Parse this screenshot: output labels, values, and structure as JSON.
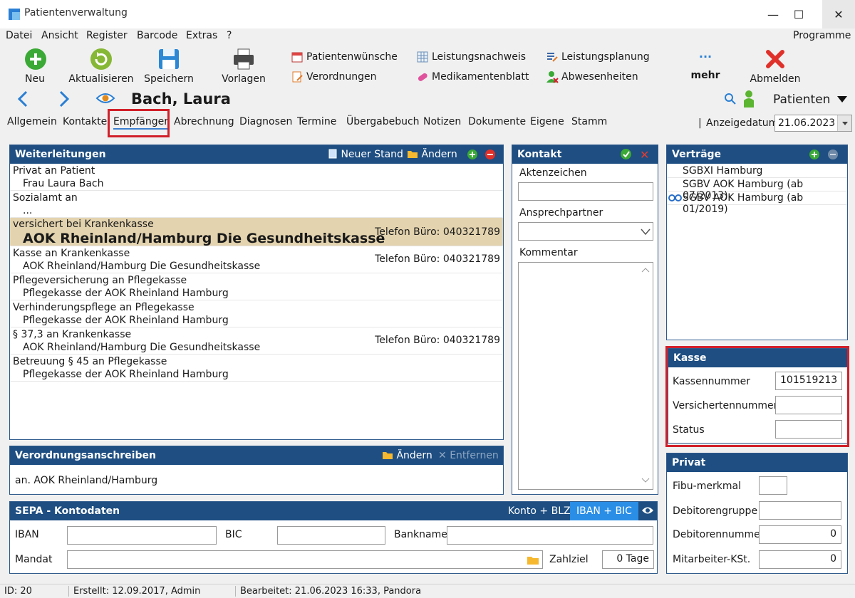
{
  "window": {
    "title": "Patientenverwaltung",
    "controls": {
      "minimize": "—",
      "maximize": "☐",
      "close": "✕"
    }
  },
  "menu": {
    "items": [
      "Datei",
      "Ansicht",
      "Register",
      "Barcode",
      "Extras",
      "?"
    ],
    "right": "Programme"
  },
  "toolbar": {
    "neu": "Neu",
    "aktualisieren": "Aktualisieren",
    "speichern": "Speichern",
    "vorlagen": "Vorlagen",
    "patientenwuensche": "Patientenwünsche",
    "verordnungen": "Verordnungen",
    "leistungsnachweis": "Leistungsnachweis",
    "medikamentenblatt": "Medikamentenblatt",
    "leistungsplanung": "Leistungsplanung",
    "abwesenheiten": "Abwesenheiten",
    "mehr_dots": "···",
    "mehr": "mehr",
    "abmelden": "Abmelden"
  },
  "nav": {
    "patient_name": "Bach, Laura",
    "patienten_dropdown": "Patienten"
  },
  "tabs": [
    "Allgemein",
    "Kontakte",
    "Empfänger",
    "Abrechnung",
    "Diagnosen",
    "Termine",
    "Übergabebuch",
    "Notizen",
    "Dokumente",
    "Eigene",
    "Stamm"
  ],
  "active_tab": "Empfänger",
  "anzeigedatum": {
    "sep": "|",
    "label": "Anzeigedatum",
    "value": "21.06.2023"
  },
  "weiterleitungen": {
    "title": "Weiterleitungen",
    "neuer_stand": "Neuer Stand",
    "aendern": "Ändern",
    "rows": [
      {
        "line1": "Privat an Patient",
        "line2": "Frau Laura Bach",
        "tel": ""
      },
      {
        "line1": "Sozialamt an",
        "line2": "...",
        "tel": ""
      },
      {
        "line1": "versichert bei Krankenkasse",
        "line2": "AOK Rheinland/Hamburg Die Gesundheitskasse",
        "tel": "Telefon Büro: 040321789"
      },
      {
        "line1": "Kasse an Krankenkasse",
        "line2": "AOK Rheinland/Hamburg Die Gesundheitskasse",
        "tel": "Telefon Büro: 040321789"
      },
      {
        "line1": "Pflegeversicherung an Pflegekasse",
        "line2": "Pflegekasse der AOK Rheinland Hamburg",
        "tel": ""
      },
      {
        "line1": "Verhinderungspflege an Pflegekasse",
        "line2": "Pflegekasse der AOK Rheinland Hamburg",
        "tel": ""
      },
      {
        "line1": "§ 37,3 an Krankenkasse",
        "line2": "AOK Rheinland/Hamburg Die Gesundheitskasse",
        "tel": "Telefon Büro: 040321789"
      },
      {
        "line1": "Betreuung § 45 an Pflegekasse",
        "line2": "Pflegekasse der AOK Rheinland Hamburg",
        "tel": ""
      }
    ]
  },
  "verordnung": {
    "title": "Verordnungsanschreiben",
    "aendern": "Ändern",
    "entfernen": "Entfernen",
    "text": "an. AOK Rheinland/Hamburg"
  },
  "sepa": {
    "title": "SEPA - Kontodaten",
    "konto_blz": "Konto + BLZ",
    "iban_bic": "IBAN + BIC",
    "iban_label": "IBAN",
    "bic_label": "BIC",
    "bankname_label": "Bankname",
    "mandat_label": "Mandat",
    "zahlziel_label": "Zahlziel",
    "zahlziel_value": "0 Tage"
  },
  "kontakt": {
    "title": "Kontakt",
    "aktenzeichen": "Aktenzeichen",
    "ansprechpartner": "Ansprechpartner",
    "kommentar": "Kommentar"
  },
  "vertraege": {
    "title": "Verträge",
    "items": [
      "SGBXI Hamburg",
      "SGBV AOK Hamburg (ab 07/2013)",
      "SGBV AOK Hamburg (ab 01/2019)"
    ]
  },
  "kasse": {
    "title": "Kasse",
    "kassennummer_label": "Kassennummer",
    "kassennummer_value": "101519213",
    "versichertennummer_label": "Versichertennummer",
    "status_label": "Status"
  },
  "privat": {
    "title": "Privat",
    "fibu_label": "Fibu-merkmal",
    "debitorengruppe_label": "Debitorengruppe",
    "debitorennummer_label": "Debitorennummer",
    "debitorennummer_value": "0",
    "mitarbeiter_label": "Mitarbeiter-KSt.",
    "mitarbeiter_value": "0"
  },
  "status": {
    "id": "ID: 20",
    "erstellt": "Erstellt: 12.09.2017, Admin",
    "bearbeitet": "Bearbeitet: 21.06.2023 16:33, Pandora"
  },
  "colors": {
    "panel_header": "#1e4e82",
    "highlight_row": "#e3d3ae",
    "accent_red": "#d1202a",
    "tab_active_underline": "#3c7fd1"
  }
}
